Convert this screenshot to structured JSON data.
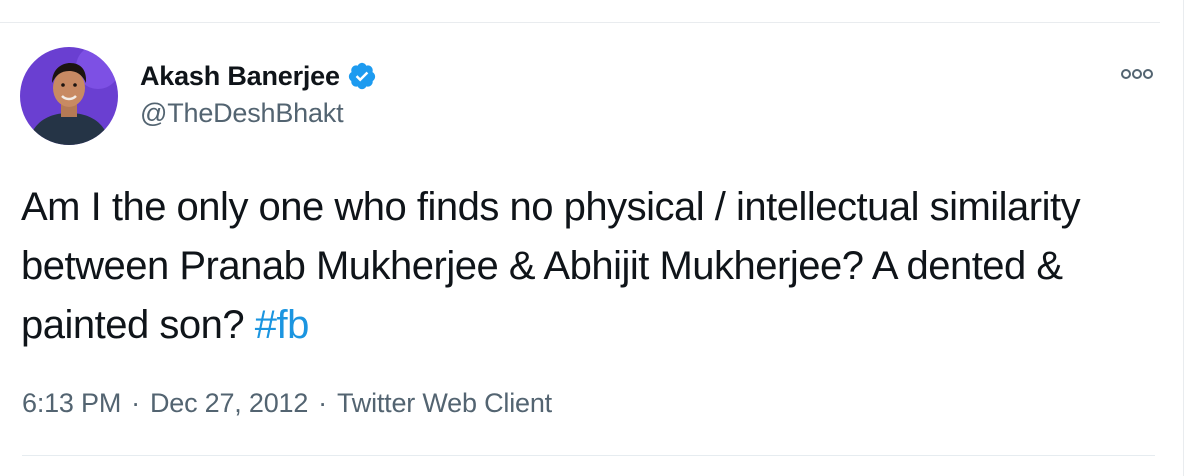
{
  "user": {
    "display_name": "Akash Banerjee",
    "handle": "@TheDeshBhakt",
    "verified": true
  },
  "tweet": {
    "text_main": "Am I the only one who finds no physical / intellectual similarity between Pranab Mukherjee & Abhijit Mukherjee? A dented & painted son? ",
    "hashtag": "#fb"
  },
  "meta": {
    "time": "6:13 PM",
    "separator": "·",
    "date": "Dec 27, 2012",
    "client": "Twitter Web Client"
  },
  "icons": {
    "verified": "verified-badge-icon",
    "more": "more-options-icon"
  },
  "colors": {
    "accent": "#1b95e0",
    "text": "#0f1419",
    "muted": "#536471",
    "verified": "#1d9bf0",
    "avatar_bg": "#6a3fd1"
  }
}
